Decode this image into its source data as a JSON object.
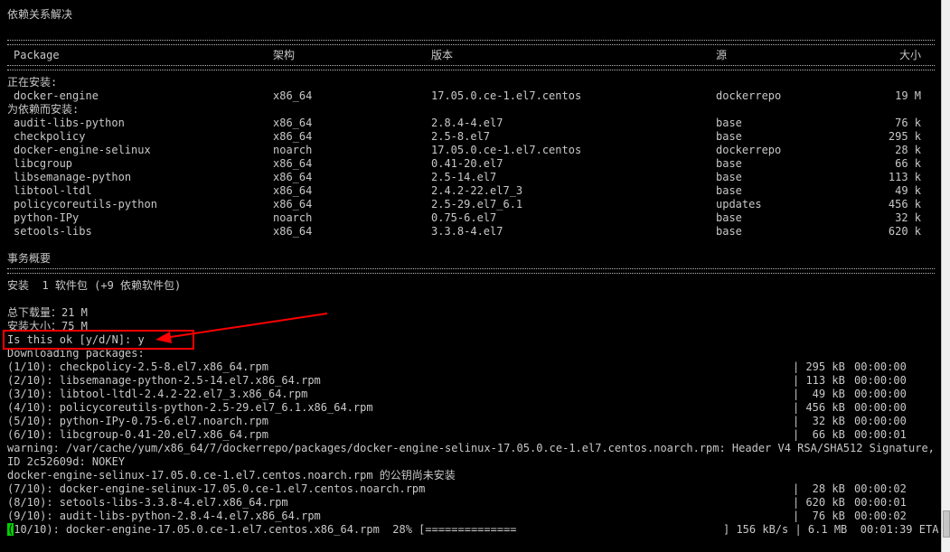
{
  "header": {
    "title": "依赖关系解决"
  },
  "table": {
    "columns": {
      "package": "Package",
      "arch": "架构",
      "version": "版本",
      "repo": "源",
      "size": "大小"
    },
    "installing_label": "正在安装:",
    "installing": [
      {
        "name": "docker-engine",
        "arch": "x86_64",
        "version": "17.05.0.ce-1.el7.centos",
        "repo": "dockerrepo",
        "size": "19 M"
      }
    ],
    "deps_label": "为依赖而安装:",
    "deps": [
      {
        "name": "audit-libs-python",
        "arch": "x86_64",
        "version": "2.8.4-4.el7",
        "repo": "base",
        "size": "76 k"
      },
      {
        "name": "checkpolicy",
        "arch": "x86_64",
        "version": "2.5-8.el7",
        "repo": "base",
        "size": "295 k"
      },
      {
        "name": "docker-engine-selinux",
        "arch": "noarch",
        "version": "17.05.0.ce-1.el7.centos",
        "repo": "dockerrepo",
        "size": "28 k"
      },
      {
        "name": "libcgroup",
        "arch": "x86_64",
        "version": "0.41-20.el7",
        "repo": "base",
        "size": "66 k"
      },
      {
        "name": "libsemanage-python",
        "arch": "x86_64",
        "version": "2.5-14.el7",
        "repo": "base",
        "size": "113 k"
      },
      {
        "name": "libtool-ltdl",
        "arch": "x86_64",
        "version": "2.4.2-22.el7_3",
        "repo": "base",
        "size": "49 k"
      },
      {
        "name": "policycoreutils-python",
        "arch": "x86_64",
        "version": "2.5-29.el7_6.1",
        "repo": "updates",
        "size": "456 k"
      },
      {
        "name": "python-IPy",
        "arch": "noarch",
        "version": "0.75-6.el7",
        "repo": "base",
        "size": "32 k"
      },
      {
        "name": "setools-libs",
        "arch": "x86_64",
        "version": "3.3.8-4.el7",
        "repo": "base",
        "size": "620 k"
      }
    ]
  },
  "summary": {
    "title": "事务概要",
    "install_line": "安装  1 软件包 (+9 依赖软件包)",
    "download_size": "总下载量：21 M",
    "installed_size": "安装大小：75 M",
    "prompt": "Is this ok [y/d/N]: y",
    "downloading": "Downloading packages:"
  },
  "downloads_a": [
    {
      "file": "(1/10): checkpolicy-2.5-8.el7.x86_64.rpm",
      "size": "| 295 kB",
      "time": "00:00:00"
    },
    {
      "file": "(2/10): libsemanage-python-2.5-14.el7.x86_64.rpm",
      "size": "| 113 kB",
      "time": "00:00:00"
    },
    {
      "file": "(3/10): libtool-ltdl-2.4.2-22.el7_3.x86_64.rpm",
      "size": "|  49 kB",
      "time": "00:00:00"
    },
    {
      "file": "(4/10): policycoreutils-python-2.5-29.el7_6.1.x86_64.rpm",
      "size": "| 456 kB",
      "time": "00:00:00"
    },
    {
      "file": "(5/10): python-IPy-0.75-6.el7.noarch.rpm",
      "size": "|  32 kB",
      "time": "00:00:00"
    },
    {
      "file": "(6/10): libcgroup-0.41-20.el7.x86_64.rpm",
      "size": "|  66 kB",
      "time": "00:00:01"
    }
  ],
  "warning": {
    "line1": "warning: /var/cache/yum/x86_64/7/dockerrepo/packages/docker-engine-selinux-17.05.0.ce-1.el7.centos.noarch.rpm: Header V4 RSA/SHA512 Signature, key",
    "line2": "ID 2c52609d: NOKEY",
    "line3": "docker-engine-selinux-17.05.0.ce-1.el7.centos.noarch.rpm 的公钥尚未安装"
  },
  "downloads_b": [
    {
      "file": "(7/10): docker-engine-selinux-17.05.0.ce-1.el7.centos.noarch.rpm",
      "size": "|  28 kB",
      "time": "00:00:02"
    },
    {
      "file": "(8/10): setools-libs-3.3.8-4.el7.x86_64.rpm",
      "size": "| 620 kB",
      "time": "00:00:01"
    },
    {
      "file": "(9/10): audit-libs-python-2.8.4-4.el7.x86_64.rpm",
      "size": "|  76 kB",
      "time": "00:00:02"
    }
  ],
  "progress": {
    "cursor_char": "(",
    "text": "10/10): docker-engine-17.05.0.ce-1.el7.centos.x86_64.rpm  28% [==============",
    "rate": "] 156 kB/s | 6.1 MB  00:01:39 ETA",
    "percent": 28
  },
  "colors": {
    "background": "#000000",
    "text": "#c8c8c8",
    "annotation": "#ff0000",
    "cursor": "#00d000"
  }
}
